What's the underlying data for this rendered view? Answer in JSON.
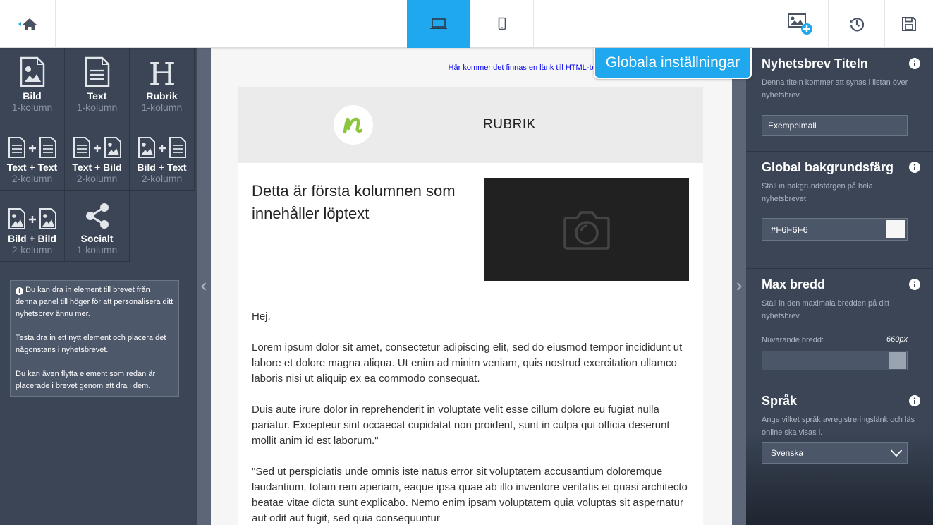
{
  "colors": {
    "accent": "#1fa8ee",
    "panel": "#3b4556",
    "strip": "#5c6678",
    "canvas_bg": "#f6f6f6",
    "header_bg": "#ebebeb",
    "image_placeholder": "#212121",
    "logo_green": "#8cc63f"
  },
  "topbar": {
    "home_icon": "home-icon",
    "device_desktop_icon": "laptop-icon",
    "device_mobile_icon": "mobile-icon",
    "add_image_icon": "image-add-icon",
    "history_icon": "history-icon",
    "save_icon": "save-icon"
  },
  "elements": [
    {
      "label": "Bild",
      "sub": "1-kolumn",
      "icon": "image-icon"
    },
    {
      "label": "Text",
      "sub": "1-kolumn",
      "icon": "text-icon"
    },
    {
      "label": "Rubrik",
      "sub": "1-kolumn",
      "icon": "heading-icon"
    },
    {
      "label": "Text + Text",
      "sub": "2-kolumn",
      "icon": "text-text-icon"
    },
    {
      "label": "Text + Bild",
      "sub": "2-kolumn",
      "icon": "text-image-icon"
    },
    {
      "label": "Bild + Text",
      "sub": "2-kolumn",
      "icon": "image-text-icon"
    },
    {
      "label": "Bild + Bild",
      "sub": "2-kolumn",
      "icon": "image-image-icon"
    },
    {
      "label": "Socialt",
      "sub": "1-kolumn",
      "icon": "share-icon"
    }
  ],
  "info_box": {
    "p1": "Du kan dra in element till brevet från denna panel till höger för att personalisera ditt nyhetsbrev ännu mer.",
    "p2": "Testa dra in ett nytt element och placera det någonstans i nyhetsbrevet.",
    "p3": "Du kan även flytta element som redan är placerade i brevet genom att dra i dem."
  },
  "newsletter": {
    "online_link": "Här kommer det finnas en länk till HTML-brevet online",
    "logo_letter": "n",
    "header_title": "RUBRIK",
    "column_title": "Detta är första kolumnen som innehåller löptext",
    "greeting": "Hej,",
    "paragraphs": [
      "Lorem ipsum dolor sit amet, consectetur adipiscing elit, sed do eiusmod tempor incididunt ut labore et dolore magna aliqua. Ut enim ad minim veniam, quis nostrud exercitation ullamco laboris nisi ut aliquip ex ea commodo consequat.",
      "Duis aute irure dolor in reprehenderit in voluptate velit esse cillum dolore eu fugiat nulla pariatur. Excepteur sint occaecat cupidatat non proident, sunt in culpa qui officia deserunt mollit anim id est laborum.\"",
      "\"Sed ut perspiciatis unde omnis iste natus error sit voluptatem accusantium doloremque laudantium, totam rem aperiam, eaque ipsa quae ab illo inventore veritatis et quasi architecto beatae vitae dicta sunt explicabo. Nemo enim ipsam voluptatem quia voluptas sit aspernatur aut odit aut fugit, sed quia consequuntur"
    ]
  },
  "global_tab": "Globala inställningar",
  "settings": {
    "title": {
      "heading": "Nyhetsbrev Titeln",
      "desc": "Denna titeln kommer att synas i listan över nyhetsbrev.",
      "value": "Exempelmall"
    },
    "background": {
      "heading": "Global bakgrundsfärg",
      "desc": "Ställ in bakgrundsfärgen på hela nyhetsbrevet.",
      "value": "#F6F6F6"
    },
    "max_width": {
      "heading": "Max bredd",
      "desc": "Ställ in den maximala bredden på ditt nyhetsbrev.",
      "current_label": "Nuvarande bredd:",
      "current_value": "660px",
      "slider_fraction": 1.0
    },
    "language": {
      "heading": "Språk",
      "desc": "Ange vilket språk avregistreringslänk och läs online ska visas i.",
      "selected": "Svenska"
    }
  }
}
